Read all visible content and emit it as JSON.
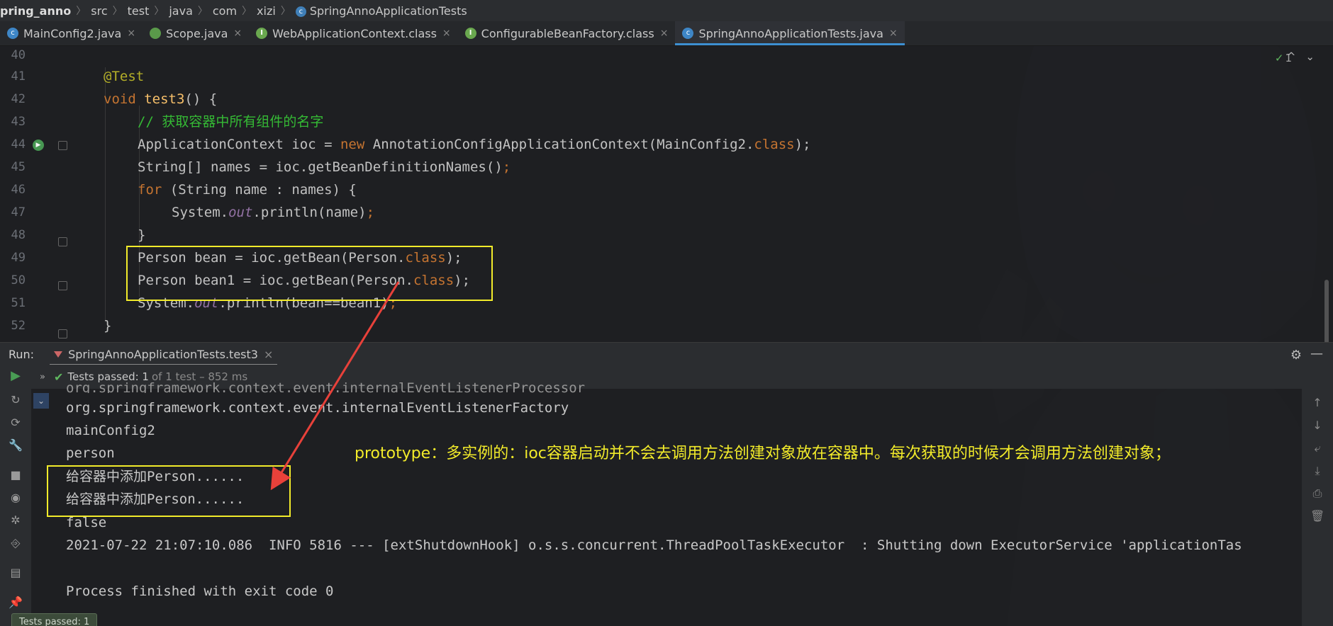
{
  "breadcrumb": {
    "items": [
      "pring_anno",
      "src",
      "test",
      "java",
      "com",
      "xizi",
      "SpringAnnoApplicationTests"
    ],
    "separator": "〉"
  },
  "tabs": [
    {
      "label": "MainConfig2.java",
      "icon": "class-icon"
    },
    {
      "label": "Scope.java",
      "icon": "annotation-icon"
    },
    {
      "label": "WebApplicationContext.class",
      "icon": "interface-icon"
    },
    {
      "label": "ConfigurableBeanFactory.class",
      "icon": "interface-icon"
    },
    {
      "label": "SpringAnnoApplicationTests.java",
      "icon": "class-icon",
      "active": true
    }
  ],
  "tab_close_glyph": "×",
  "editor": {
    "line_numbers": [
      "40",
      "41",
      "42",
      "43",
      "44",
      "45",
      "46",
      "47",
      "48",
      "49",
      "50",
      "51",
      "52"
    ],
    "line_41": "@Test",
    "line_42_kw": "void",
    "line_42_fn": "test3",
    "line_42_rest": "() {",
    "line_43_comment": "// 获取容器中所有组件的名字",
    "line_44_a": "ApplicationContext ioc = ",
    "line_44_new": "new",
    "line_44_b": " AnnotationConfigApplicationContext(MainConfig2.",
    "line_44_class": "class",
    "line_44_end": ");",
    "line_45_a": "String[] names = ioc.getBeanDefinitionNames()",
    "line_45_end": ";",
    "line_46_for": "for",
    "line_46_rest": " (String name : names) {",
    "line_47_a": "System.",
    "line_47_out": "out",
    "line_47_b": ".println(name)",
    "line_47_end": ";",
    "line_48": "}",
    "line_49_a": "Person bean = ioc.getBean(Person.",
    "line_49_class": "class",
    "line_49_end": ");",
    "line_50_a": "Person bean1 = ioc.getBean(Person.",
    "line_50_class": "class",
    "line_50_end": ");",
    "line_51_a": "System.",
    "line_51_out": "out",
    "line_51_b": ".println(bean==bean1)",
    "line_51_end": ";",
    "line_52": "}",
    "inspection_count": "1"
  },
  "run_panel": {
    "label": "Run:",
    "tab_label": "SpringAnnoApplicationTests.test3",
    "status_strong": "Tests passed: 1",
    "status_sub": "of 1 test – 852 ms",
    "console_partial": "org.springframework.context.event.internalEventListenerProcessor",
    "console_lines": [
      "org.springframework.context.event.internalEventListenerFactory",
      "mainConfig2",
      "person",
      "给容器中添加Person......",
      "给容器中添加Person......",
      "false",
      "2021-07-22 21:07:10.086  INFO 5816 --- [extShutdownHook] o.s.s.concurrent.ThreadPoolTaskExecutor  : Shutting down ExecutorService 'applicationTas",
      "",
      "Process finished with exit code 0"
    ]
  },
  "annotation_text": "prototype：多实例的：ioc容器启动并不会去调用方法创建对象放在容器中。每次获取的时候才会调用方法创建对象；",
  "tooltip": "Tests passed: 1",
  "colors": {
    "keyword": "#cc7832",
    "annotation": "#bbb529",
    "method": "#ffc66d",
    "comment": "#36c136",
    "highlight": "#f2eb2a",
    "pass": "#5fb85f"
  }
}
